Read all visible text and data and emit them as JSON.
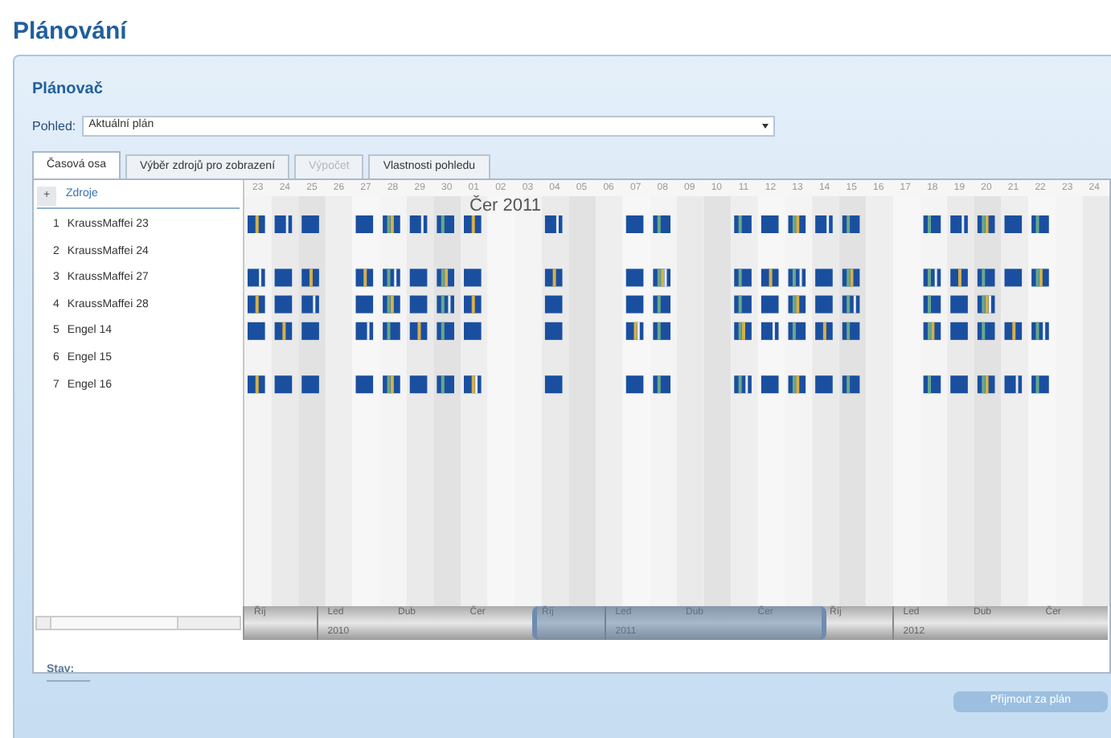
{
  "page_title": "Plánování",
  "panel": {
    "title": "Plánovač",
    "view_label": "Pohled:",
    "view_value": "Aktuální plán"
  },
  "tabs": [
    {
      "label": "Časová osa",
      "selected": true,
      "disabled": false
    },
    {
      "label": "Výběr zdrojů pro zobrazení",
      "selected": false,
      "disabled": false
    },
    {
      "label": "Výpočet",
      "selected": false,
      "disabled": true
    },
    {
      "label": "Vlastnosti pohledu",
      "selected": false,
      "disabled": false
    }
  ],
  "resources": {
    "toggle": "+",
    "heading": "Zdroje",
    "items": [
      {
        "number": "1",
        "name": "KraussMaffei 23"
      },
      {
        "number": "2",
        "name": "KraussMaffei 24"
      },
      {
        "number": "3",
        "name": "KraussMaffei 27"
      },
      {
        "number": "4",
        "name": "KraussMaffei 28"
      },
      {
        "number": "5",
        "name": "Engel 14"
      },
      {
        "number": "6",
        "name": "Engel 15"
      },
      {
        "number": "7",
        "name": "Engel 16"
      }
    ]
  },
  "timeline": {
    "days": [
      "23",
      "24",
      "25",
      "26",
      "27",
      "28",
      "29",
      "30",
      "01",
      "02",
      "03",
      "04",
      "05",
      "06",
      "07",
      "08",
      "09",
      "10",
      "11",
      "12",
      "13",
      "14",
      "15",
      "16",
      "17",
      "18",
      "19",
      "20",
      "21",
      "22",
      "23",
      "24"
    ],
    "month_label": "Čer 2011"
  },
  "navigator": {
    "months": [
      {
        "label": "Říj"
      },
      {
        "label": "Led",
        "year": "2010"
      },
      {
        "label": "Dub"
      },
      {
        "label": "Čer"
      },
      {
        "label": "Říj"
      },
      {
        "label": "Led",
        "year": "2011"
      },
      {
        "label": "Dub"
      },
      {
        "label": "Čer"
      },
      {
        "label": "Říj"
      },
      {
        "label": "Led",
        "year": "2012"
      },
      {
        "label": "Dub"
      },
      {
        "label": "Čer"
      }
    ]
  },
  "status_label": "Stav:",
  "accept_button": {
    "label": "Přijmout za plán",
    "disabled": true
  }
}
